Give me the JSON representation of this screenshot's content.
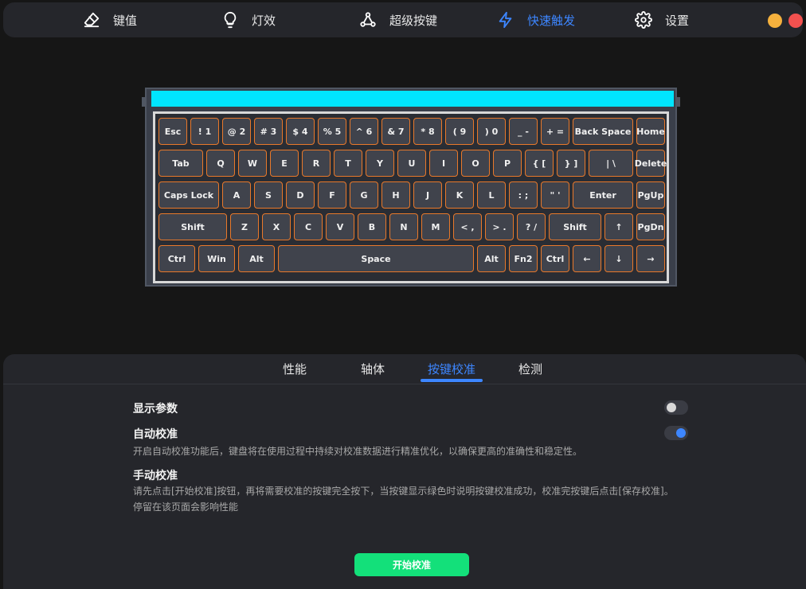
{
  "nav": {
    "items": [
      {
        "label": "键值",
        "icon": "eraser-icon",
        "active": false
      },
      {
        "label": "灯效",
        "icon": "bulb-icon",
        "active": false
      },
      {
        "label": "超级按键",
        "icon": "nodes-icon",
        "active": false
      },
      {
        "label": "快速触发",
        "icon": "lightning-icon",
        "active": true
      },
      {
        "label": "设置",
        "icon": "gear-icon",
        "active": false
      }
    ],
    "window_controls": {
      "minimize_color": "#f5b13d",
      "close_color": "#f2514f"
    }
  },
  "keyboard": {
    "light_color": "#00e5ff",
    "key_border_color": "#e8782a",
    "rows": [
      [
        "Esc",
        "! 1",
        "@ 2",
        "# 3",
        "$ 4",
        "% 5",
        "^ 6",
        "& 7",
        "* 8",
        "( 9",
        ") 0",
        "_ -",
        "+ =",
        "Back Space",
        "Home"
      ],
      [
        "Tab",
        "Q",
        "W",
        "E",
        "R",
        "T",
        "Y",
        "U",
        "I",
        "O",
        "P",
        "{ [",
        "} ]",
        "| \\",
        "Delete"
      ],
      [
        "Caps Lock",
        "A",
        "S",
        "D",
        "F",
        "G",
        "H",
        "J",
        "K",
        "L",
        ": ;",
        "\" '",
        "Enter",
        "PgUp"
      ],
      [
        "Shift",
        "Z",
        "X",
        "C",
        "V",
        "B",
        "N",
        "M",
        "< ,",
        "> .",
        "? /",
        "Shift",
        "↑",
        "PgDn"
      ],
      [
        "Ctrl",
        "Win",
        "Alt",
        "Space",
        "Alt",
        "Fn2",
        "Ctrl",
        "←",
        "↓",
        "→"
      ]
    ]
  },
  "tabs": [
    {
      "label": "性能",
      "active": false
    },
    {
      "label": "轴体",
      "active": false
    },
    {
      "label": "按键校准",
      "active": true
    },
    {
      "label": "检测",
      "active": false
    }
  ],
  "settings": {
    "show_params": {
      "label": "显示参数",
      "enabled": false
    },
    "auto_calibrate": {
      "label": "自动校准",
      "enabled": true,
      "description": "开启自动校准功能后，键盘将在使用过程中持续对校准数据进行精准优化，以确保更高的准确性和稳定性。"
    },
    "manual_calibrate": {
      "label": "手动校准",
      "description_line1": "请先点击[开始校准]按钮，再将需要校准的按键完全按下，当按键显示绿色时说明按键校准成功，校准完按键后点击[保存校准]。",
      "description_line2": "停留在该页面会影响性能"
    }
  },
  "start_button": {
    "label": "开始校准",
    "color": "#13e07a"
  }
}
